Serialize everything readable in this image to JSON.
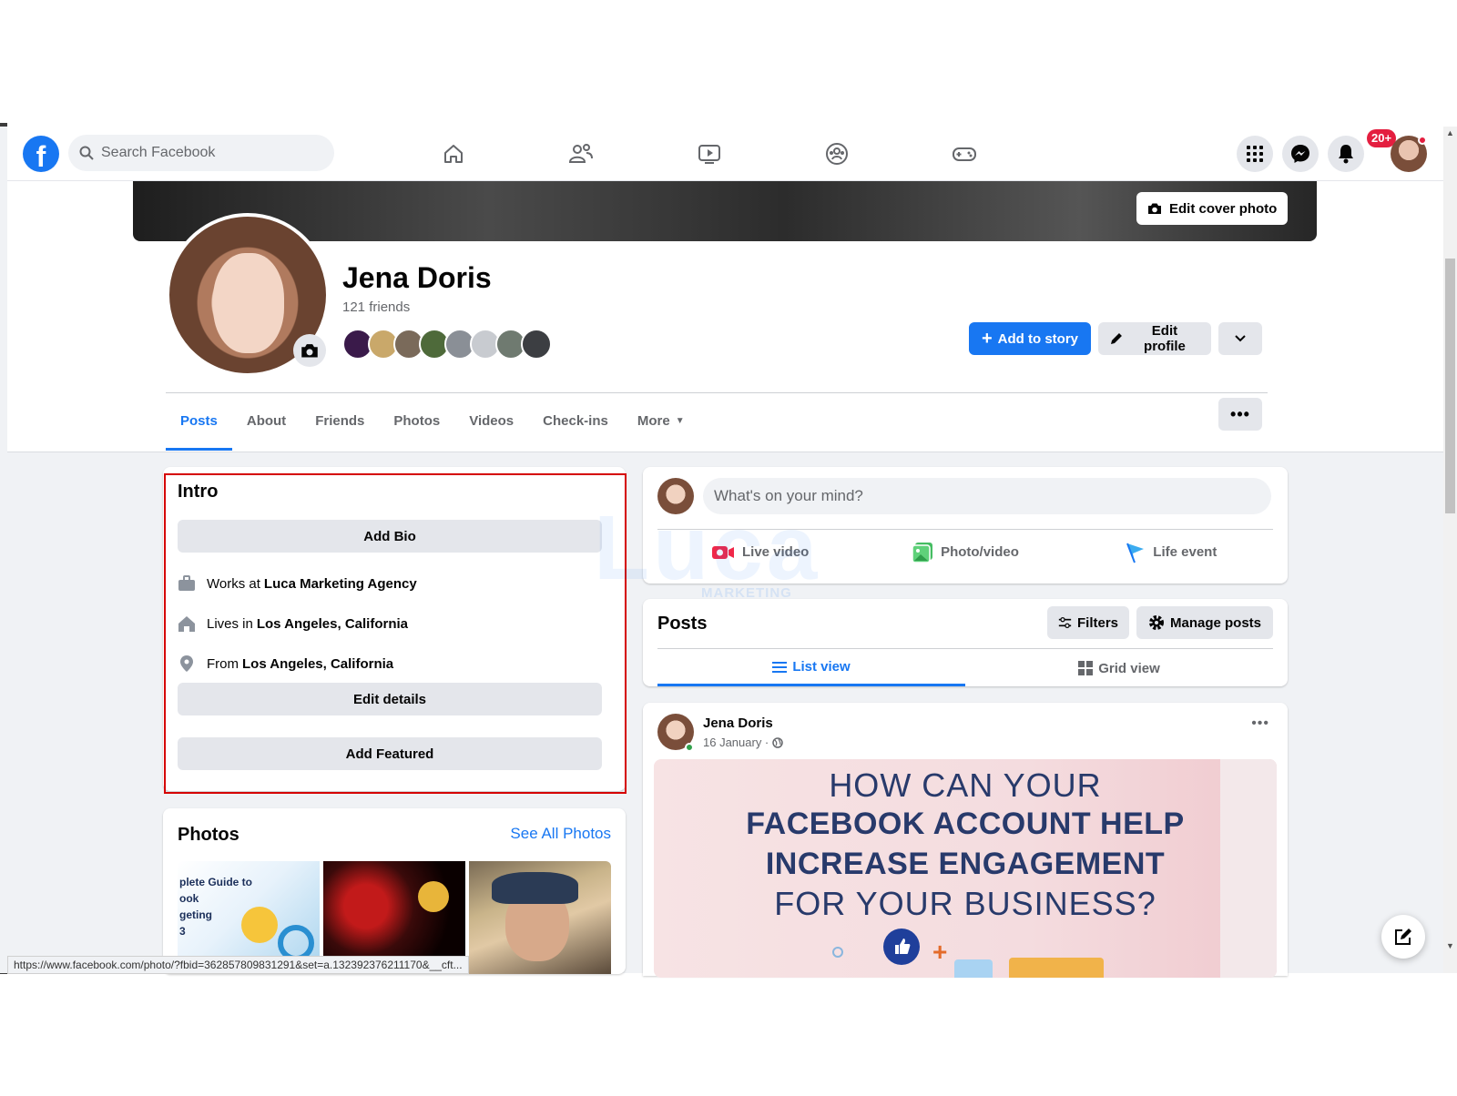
{
  "search": {
    "placeholder": "Search Facebook"
  },
  "nav": {
    "icons": [
      "home-icon",
      "friends-icon",
      "watch-icon",
      "groups-icon",
      "gaming-icon"
    ],
    "notification_badge": "20+"
  },
  "profile": {
    "edit_cover_label": "Edit cover photo",
    "name": "Jena Doris",
    "friends_count": "121 friends",
    "add_story_label": "Add to story",
    "edit_profile_label": "Edit profile"
  },
  "tabs": [
    "Posts",
    "About",
    "Friends",
    "Photos",
    "Videos",
    "Check-ins",
    "More"
  ],
  "intro": {
    "title": "Intro",
    "add_bio": "Add Bio",
    "works_prefix": "Works at",
    "works_value": "Luca Marketing Agency",
    "lives_prefix": "Lives in",
    "lives_value": "Los Angeles, California",
    "from_prefix": "From",
    "from_value": "Los Angeles, California",
    "edit_details": "Edit details",
    "add_featured": "Add Featured"
  },
  "photos": {
    "title": "Photos",
    "see_all": "See All Photos",
    "thumb1_text": "plete Guide to\nook\ngeting\n3"
  },
  "composer": {
    "placeholder": "What's on your mind?",
    "live_video": "Live video",
    "photo_video": "Photo/video",
    "life_event": "Life event"
  },
  "watermark": {
    "brand": "Luca",
    "tagline": "MARKETING AGENCY"
  },
  "posts_header": {
    "title": "Posts",
    "filters": "Filters",
    "manage": "Manage posts",
    "list_view": "List view",
    "grid_view": "Grid view"
  },
  "post": {
    "author": "Jena Doris",
    "date": "16 January ·",
    "image_lines": [
      "HOW CAN YOUR",
      "FACEBOOK ACCOUNT HELP",
      "INCREASE ENGAGEMENT",
      "FOR YOUR BUSINESS?"
    ]
  },
  "status_bar": {
    "url": "https://www.facebook.com/photo/?fbid=362857809831291&set=a.132392376211170&__cft..."
  },
  "colors": {
    "brand_blue": "#1877f2",
    "highlight_red": "#d50000",
    "badge_red": "#e41e3f"
  }
}
